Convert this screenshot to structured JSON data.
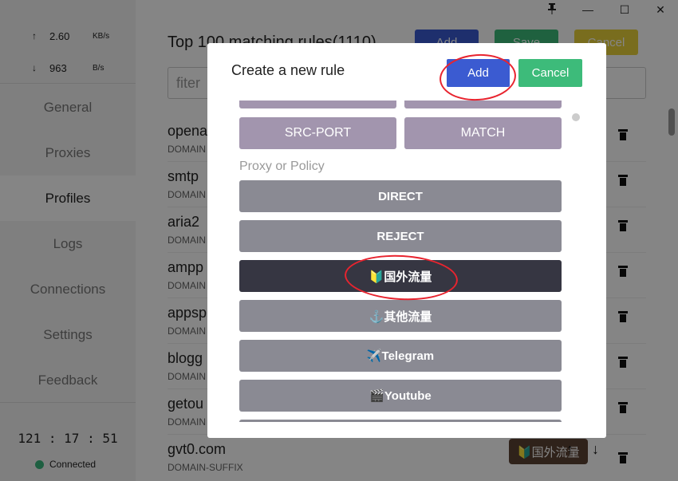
{
  "window": {
    "pin_icon": "pin-icon",
    "minimize_label": "—",
    "maximize_label": "☐",
    "close_label": "✕"
  },
  "speed": {
    "up_arrow": "↑",
    "up_value": "2.60",
    "up_unit": "KB/s",
    "down_arrow": "↓",
    "down_value": "963",
    "down_unit": "B/s"
  },
  "sidebar": {
    "items": [
      {
        "label": "General"
      },
      {
        "label": "Proxies"
      },
      {
        "label": "Profiles"
      },
      {
        "label": "Logs"
      },
      {
        "label": "Connections"
      },
      {
        "label": "Settings"
      },
      {
        "label": "Feedback"
      }
    ],
    "active": "Profiles",
    "clock": "121 : 17 : 51",
    "status": "Connected"
  },
  "main": {
    "title": "Top 100 matching rules(1110)",
    "add_label": "Add",
    "save_label": "Save",
    "cancel_label": "Cancel",
    "filter_placeholder": "fiter",
    "rules": [
      {
        "name": "opena",
        "type": "DOMAIN"
      },
      {
        "name": "smtp",
        "type": "DOMAIN"
      },
      {
        "name": "aria2",
        "type": "DOMAIN"
      },
      {
        "name": "ampp",
        "type": "DOMAIN"
      },
      {
        "name": "appsp",
        "type": "DOMAIN"
      },
      {
        "name": "blogg",
        "type": "DOMAIN"
      },
      {
        "name": "getou",
        "type": "DOMAIN"
      },
      {
        "name": "gvt0.com",
        "type": "DOMAIN-SUFFIX"
      }
    ],
    "last_row_badge": "🔰国外流量",
    "up_arrow": "↑",
    "down_arrow": "↓"
  },
  "modal": {
    "title": "Create a new rule",
    "add_label": "Add",
    "cancel_label": "Cancel",
    "rule_types": [
      "SRC-PORT",
      "MATCH"
    ],
    "section_label": "Proxy or Policy",
    "options": [
      {
        "label": "DIRECT"
      },
      {
        "label": "REJECT"
      },
      {
        "label": "🔰国外流量"
      },
      {
        "label": "⚓其他流量"
      },
      {
        "label": "✈️Telegram"
      },
      {
        "label": "🎬Youtube"
      }
    ],
    "selected": "🔰国外流量"
  },
  "colors": {
    "add_blue": "#3b5bd1",
    "cancel_green": "#3dbb7a",
    "selected_option": "#363642",
    "option_gray": "#8a8a93",
    "type_purple": "#a295ae",
    "connected_dot": "#3bb77e",
    "annotation_red": "#e8242f"
  }
}
